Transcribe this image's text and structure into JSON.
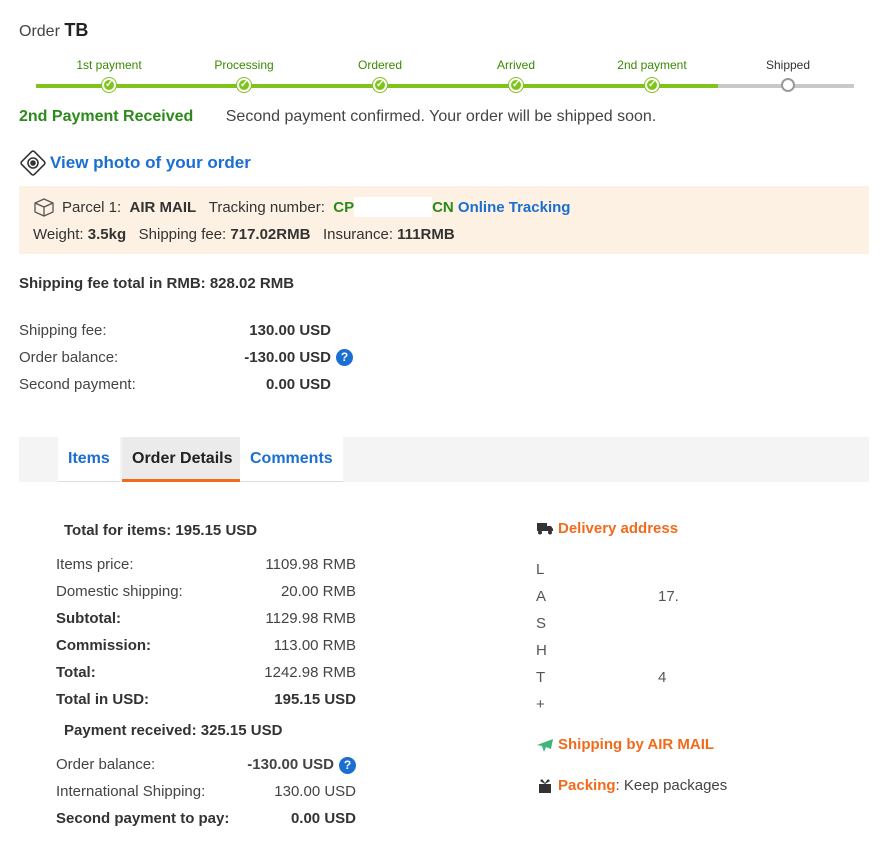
{
  "order": {
    "label": "Order",
    "id": "TB"
  },
  "steps": [
    {
      "label": "1st payment",
      "done": true
    },
    {
      "label": "Processing",
      "done": true
    },
    {
      "label": "Ordered",
      "done": true
    },
    {
      "label": "Arrived",
      "done": true
    },
    {
      "label": "2nd payment",
      "done": true
    },
    {
      "label": "Shipped",
      "done": false
    }
  ],
  "status": {
    "title": "2nd Payment Received",
    "message": "Second payment confirmed. Your order will be shipped soon."
  },
  "photo_link": "View photo of your order",
  "parcel": {
    "prefix": "Parcel 1:",
    "method": "AIR MAIL",
    "tracking_label": "Tracking number:",
    "tracking_start": "CP",
    "tracking_end": "CN",
    "online_tracking": "Online Tracking",
    "weight_label": "Weight:",
    "weight": "3.5kg",
    "fee_label": "Shipping fee:",
    "fee": "717.02RMB",
    "insurance_label": "Insurance:",
    "insurance": "111RMB"
  },
  "shipping_fee_total": "Shipping fee total in RMB: 828.02 RMB",
  "payments": {
    "shipping_fee_label": "Shipping fee:",
    "shipping_fee": "130.00 USD",
    "order_balance_label": "Order balance:",
    "order_balance": "-130.00 USD",
    "second_payment_label": "Second payment:",
    "second_payment": "0.00 USD"
  },
  "tabs": {
    "items": "Items",
    "details": "Order Details",
    "comments": "Comments"
  },
  "totals": {
    "title": "Total for items: 195.15 USD",
    "items_price_label": "Items price:",
    "items_price": "1109.98 RMB",
    "domestic_label": "Domestic shipping:",
    "domestic": "20.00 RMB",
    "subtotal_label": "Subtotal:",
    "subtotal": "1129.98 RMB",
    "commission_label": "Commission:",
    "commission": "113.00 RMB",
    "total_label": "Total:",
    "total": "1242.98 RMB",
    "total_usd_label": "Total in USD:",
    "total_usd": "195.15 USD"
  },
  "payment_received": {
    "title": "Payment received: 325.15 USD",
    "balance_label": "Order balance:",
    "balance": "-130.00 USD",
    "intl_label": "International Shipping:",
    "intl": "130.00 USD",
    "second_label": "Second payment to pay:",
    "second": "0.00 USD"
  },
  "delivery": {
    "title": "Delivery address",
    "lines": [
      "L",
      "A",
      "S",
      "H",
      "T",
      "+"
    ],
    "line2_tail": "17.",
    "line5_tail": "4"
  },
  "shipping_by": "Shipping by AIR MAIL",
  "packing": {
    "label": "Packing",
    "value": ": Keep packages"
  },
  "colors": {
    "accent_green": "#7fc31c",
    "link_blue": "#1a6fd1",
    "orange": "#f26b1d",
    "status_green": "#2c8a1b"
  }
}
